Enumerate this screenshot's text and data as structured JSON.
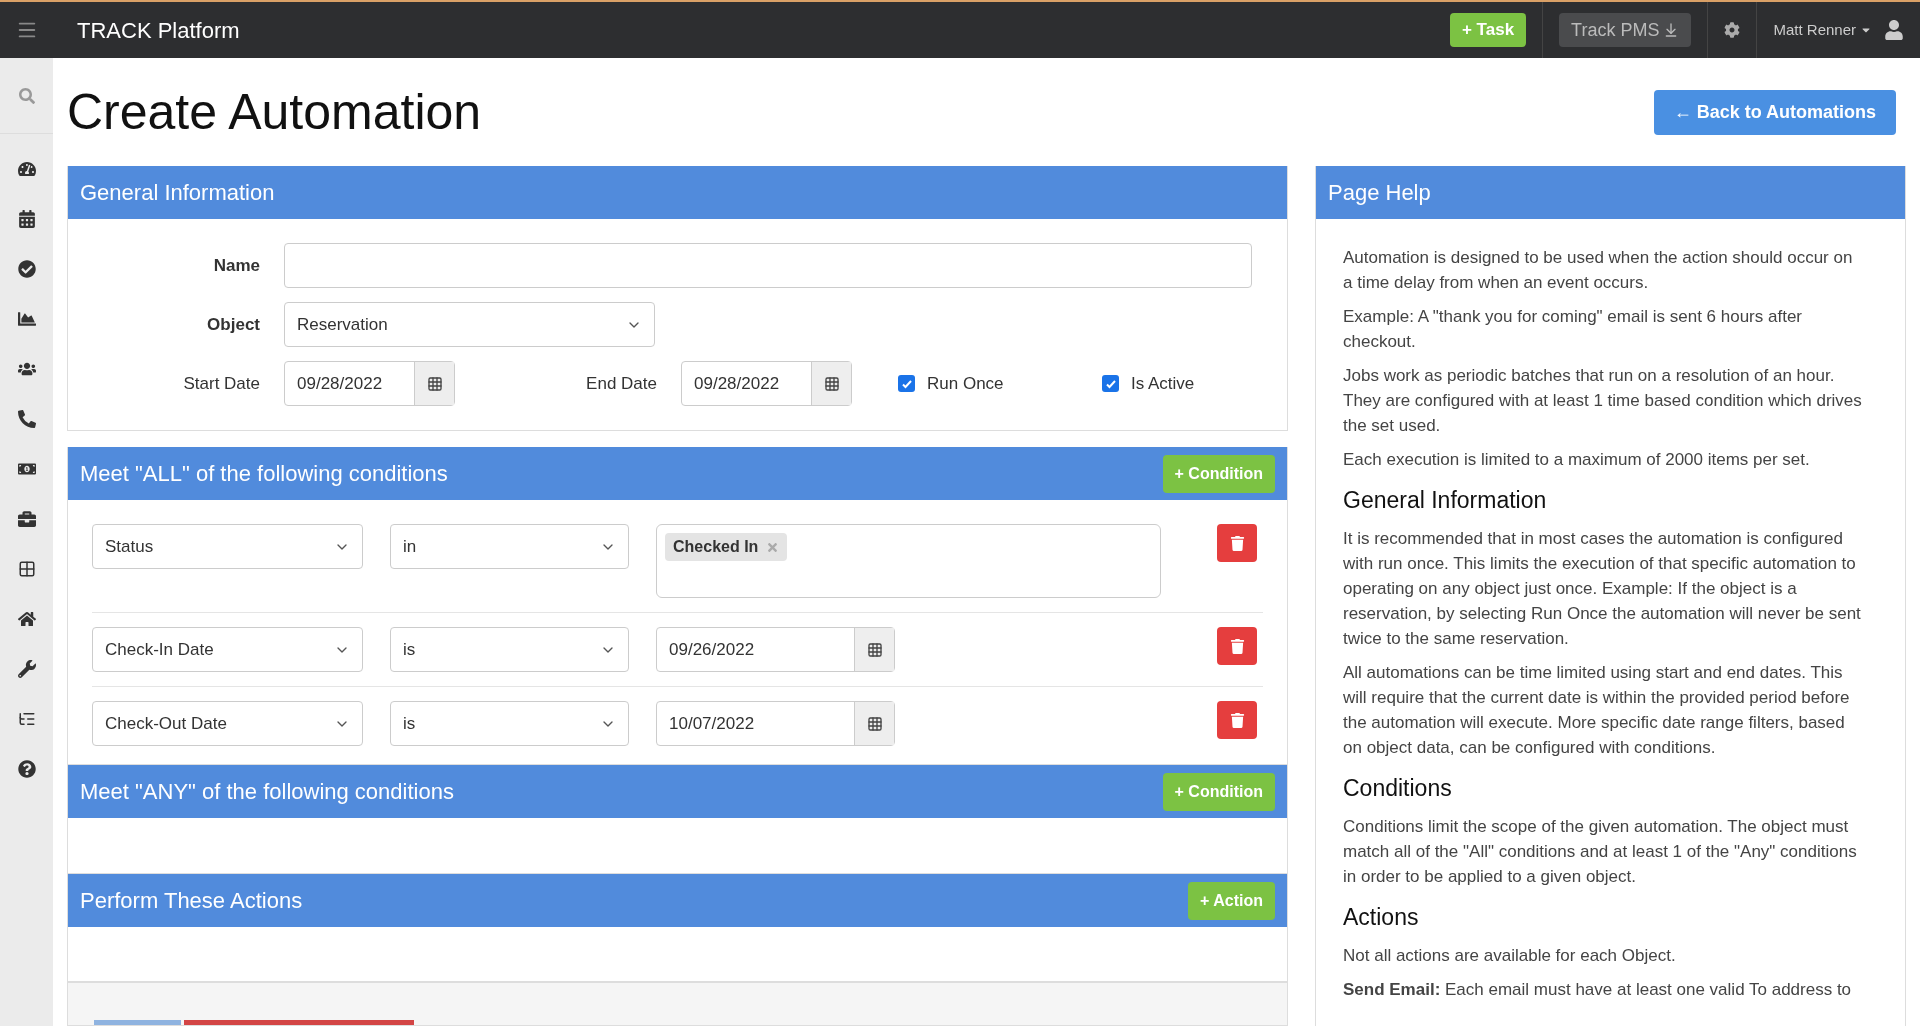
{
  "topbar": {
    "app_title": "TRACK Platform",
    "task_button": "+ Task",
    "pms_button": "Track PMS",
    "user": "Matt Renner"
  },
  "page_title": "Create Automation",
  "back_button": "← Back to Automations",
  "general": {
    "title": "General Information",
    "name_label": "Name",
    "object_label": "Object",
    "object_value": "Reservation",
    "start_label": "Start Date",
    "start_value": "09/28/2022",
    "end_label": "End Date",
    "end_value": "09/28/2022",
    "checkboxes": [
      {
        "label": "Run Once",
        "checked": true
      },
      {
        "label": "Is Active",
        "checked": true
      }
    ]
  },
  "all_conditions": {
    "title": "Meet \"ALL\" of the following conditions",
    "button": "+ Condition",
    "rows": [
      {
        "kind": "tags",
        "field": "Status",
        "operator": "in",
        "tags": [
          "Checked In"
        ]
      },
      {
        "kind": "date",
        "field": "Check-In Date",
        "operator": "is",
        "value": "09/26/2022"
      },
      {
        "kind": "date",
        "field": "Check-Out Date",
        "operator": "is",
        "value": "10/07/2022"
      }
    ]
  },
  "any_conditions": {
    "title": "Meet \"ANY\" of the following conditions",
    "button": "+ Condition"
  },
  "actions": {
    "title": "Perform These Actions",
    "button": "+ Action"
  },
  "help": {
    "title": "Page Help",
    "blocks": [
      {
        "kind": "p",
        "text": "Automation is designed to be used when the action should occur on a time delay from when an event occurs."
      },
      {
        "kind": "p",
        "text": "Example: A \"thank you for coming\" email is sent 6 hours after checkout."
      },
      {
        "kind": "p",
        "text": "Jobs work as periodic batches that run on a resolution of an hour. They are configured with at least 1 time based condition which drives the set used."
      },
      {
        "kind": "p",
        "text": "Each execution is limited to a maximum of 2000 items per set."
      },
      {
        "kind": "h",
        "text": "General Information"
      },
      {
        "kind": "p",
        "text": "It is recommended that in most cases the automation is configured with run once. This limits the execution of that specific automation to operating on any object just once. Example: If the object is a reservation, by selecting Run Once the automation will never be sent twice to the same reservation."
      },
      {
        "kind": "p",
        "text": "All automations can be time limited using start and end dates. This will require that the current date is within the provided period before the automation will execute. More specific date range filters, based on object data, can be configured with conditions."
      },
      {
        "kind": "h",
        "text": "Conditions"
      },
      {
        "kind": "p",
        "text": "Conditions limit the scope of the given automation. The object must match all of the \"All\" conditions and at least 1 of the \"Any\" conditions in order to be applied to a given object."
      },
      {
        "kind": "h",
        "text": "Actions"
      },
      {
        "kind": "p",
        "text": "Not all actions are available for each Object."
      },
      {
        "kind": "p",
        "text": "**Send Email:** Each email must have at least one valid To address to"
      }
    ]
  }
}
